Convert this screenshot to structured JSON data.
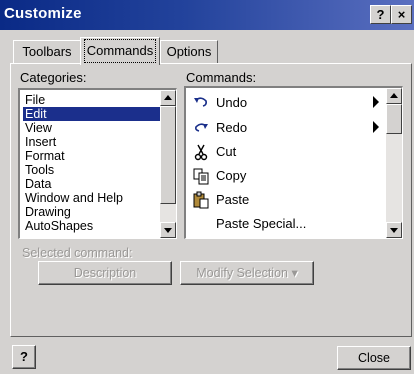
{
  "window": {
    "title": "Customize"
  },
  "titlebar": {
    "help": "?",
    "close": "×"
  },
  "tabs": [
    {
      "label": "Toolbars"
    },
    {
      "label": "Commands"
    },
    {
      "label": "Options"
    }
  ],
  "active_tab": "Commands",
  "categories": {
    "label": "Categories:",
    "items": [
      "File",
      "Edit",
      "View",
      "Insert",
      "Format",
      "Tools",
      "Data",
      "Window and Help",
      "Drawing",
      "AutoShapes"
    ],
    "selected": "Edit"
  },
  "commands": {
    "label": "Commands:",
    "items": [
      {
        "label": "Undo",
        "icon": "undo-icon",
        "submenu": true
      },
      {
        "label": "Redo",
        "icon": "redo-icon",
        "submenu": true
      },
      {
        "label": "Cut",
        "icon": "scissors-icon",
        "submenu": false
      },
      {
        "label": "Copy",
        "icon": "copy-icon",
        "submenu": false
      },
      {
        "label": "Paste",
        "icon": "paste-icon",
        "submenu": false
      },
      {
        "label": "Paste Special...",
        "icon": "",
        "submenu": false
      }
    ]
  },
  "selected_command": {
    "label": "Selected command:",
    "description_button": "Description",
    "modify_button": "Modify Selection ▾"
  },
  "footer": {
    "help_button": "?",
    "close_button": "Close"
  }
}
